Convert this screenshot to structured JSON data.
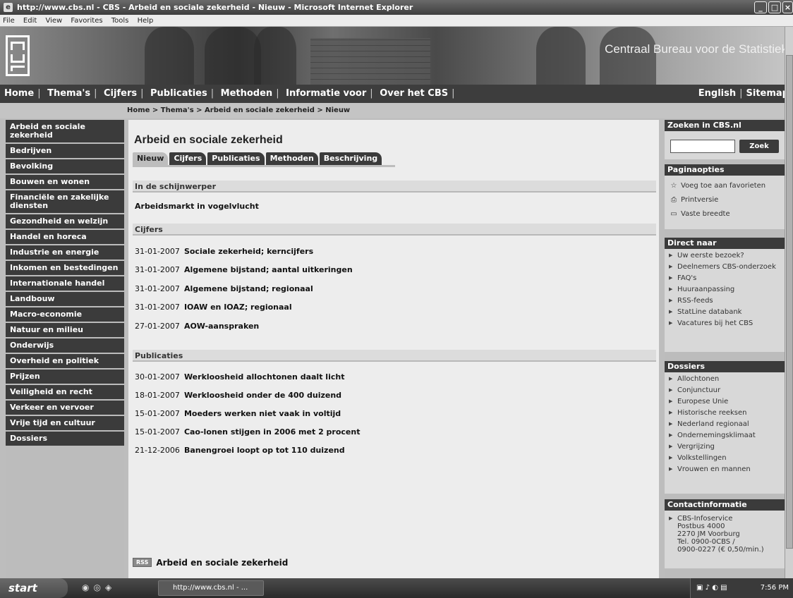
{
  "window": {
    "title": "http://www.cbs.nl - CBS - Arbeid en sociale zekerheid - Nieuw - Microsoft Internet Explorer",
    "menu": [
      "File",
      "Edit",
      "View",
      "Favorites",
      "Tools",
      "Help"
    ]
  },
  "banner": {
    "org_name": "Centraal Bureau voor de Statistiek"
  },
  "topnav": {
    "left": [
      "Home",
      "Thema's",
      "Cijfers",
      "Publicaties",
      "Methoden",
      "Informatie voor",
      "Over het CBS"
    ],
    "right": [
      "English",
      "Sitemap"
    ],
    "separator": "|"
  },
  "breadcrumb": "Home > Thema's > Arbeid en sociale zekerheid > Nieuw",
  "leftnav": [
    "Arbeid en sociale zekerheid",
    "Bedrijven",
    "Bevolking",
    "Bouwen en wonen",
    "Financiële en zakelijke diensten",
    "Gezondheid en welzijn",
    "Handel en horeca",
    "Industrie en energie",
    "Inkomen en bestedingen",
    "Internationale handel",
    "Landbouw",
    "Macro-economie",
    "Natuur en milieu",
    "Onderwijs",
    "Overheid en politiek",
    "Prijzen",
    "Veiligheid en recht",
    "Verkeer en vervoer",
    "Vrije tijd en cultuur",
    "Dossiers"
  ],
  "main": {
    "title": "Arbeid en sociale zekerheid",
    "tabs": [
      "Nieuw",
      "Cijfers",
      "Publicaties",
      "Methoden",
      "Beschrijving"
    ],
    "active_tab": "Nieuw",
    "spotlight": {
      "heading": "In de schijnwerper",
      "items": [
        "Arbeidsmarkt in vogelvlucht"
      ]
    },
    "cijfers": {
      "heading": "Cijfers",
      "items": [
        {
          "date": "31-01-2007",
          "text": "Sociale zekerheid; kerncijfers"
        },
        {
          "date": "31-01-2007",
          "text": "Algemene bijstand; aantal uitkeringen"
        },
        {
          "date": "31-01-2007",
          "text": "Algemene bijstand; regionaal"
        },
        {
          "date": "31-01-2007",
          "text": "IOAW en IOAZ; regionaal"
        },
        {
          "date": "27-01-2007",
          "text": "AOW-aanspraken"
        }
      ]
    },
    "publicaties": {
      "heading": "Publicaties",
      "items": [
        {
          "date": "30-01-2007",
          "text": "Werkloosheid allochtonen daalt licht"
        },
        {
          "date": "18-01-2007",
          "text": "Werkloosheid onder de 400 duizend"
        },
        {
          "date": "15-01-2007",
          "text": "Moeders werken niet vaak in voltijd"
        },
        {
          "date": "15-01-2007",
          "text": "Cao-lonen stijgen in 2006 met 2 procent"
        },
        {
          "date": "21-12-2006",
          "text": "Banengroei loopt op tot 110 duizend"
        }
      ]
    },
    "rss": {
      "badge": "RSS",
      "label": "Arbeid en sociale zekerheid"
    }
  },
  "sidebar": {
    "search": {
      "heading": "Zoeken in CBS.nl",
      "button": "Zoek",
      "value": ""
    },
    "page_options": {
      "heading": "Paginaopties",
      "items": [
        "Voeg toe aan favorieten",
        "Printversie",
        "Vaste breedte"
      ]
    },
    "direct": {
      "heading": "Direct naar",
      "items": [
        "Uw eerste bezoek?",
        "Deelnemers CBS-onderzoek",
        "FAQ's",
        "Huuraanpassing",
        "RSS-feeds",
        "StatLine databank",
        "Vacatures bij het CBS"
      ]
    },
    "dossiers": {
      "heading": "Dossiers",
      "items": [
        "Allochtonen",
        "Conjunctuur",
        "Europese Unie",
        "Historische reeksen",
        "Nederland regionaal",
        "Ondernemingsklimaat",
        "Vergrijzing",
        "Volkstellingen",
        "Vrouwen en mannen"
      ]
    },
    "contact": {
      "heading": "Contactinformatie",
      "lines": [
        "CBS-Infoservice",
        "Postbus 4000",
        "2270 JM Voorburg",
        "Tel. 0900-0CBS /",
        "0900-0227 (€ 0,50/min.)"
      ]
    }
  },
  "taskbar": {
    "start": "start",
    "task": "http://www.cbs.nl - ...",
    "clock": "7:56 PM"
  }
}
